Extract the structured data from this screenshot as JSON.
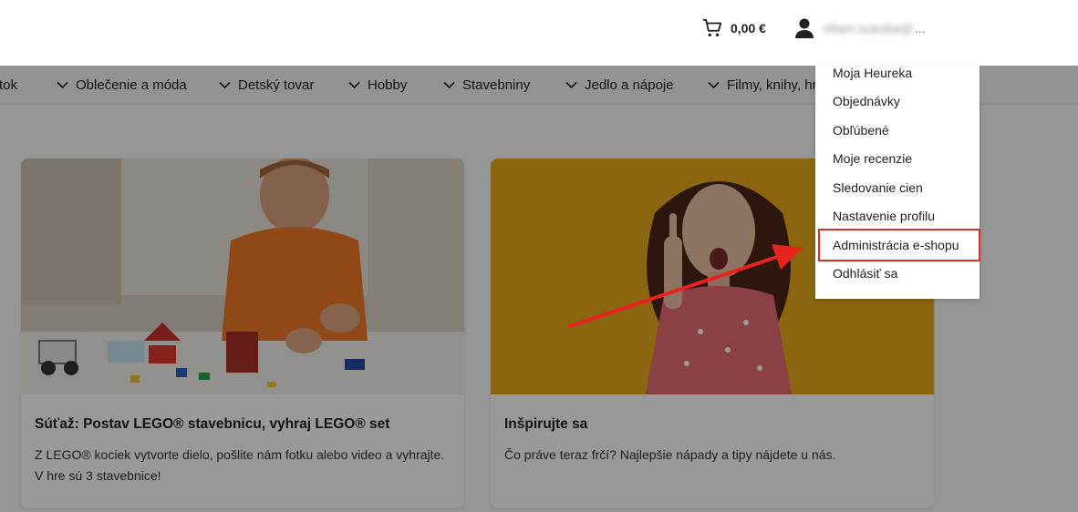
{
  "header": {
    "cart_amount": "0,00 €",
    "user_email": "viliam.sukuba@",
    "user_ellipsis": "..."
  },
  "nav": {
    "items": [
      {
        "label": "tok"
      },
      {
        "label": "Oblečenie a móda"
      },
      {
        "label": "Detský tovar"
      },
      {
        "label": "Hobby"
      },
      {
        "label": "Stavebniny"
      },
      {
        "label": "Jedlo a nápoje"
      },
      {
        "label": "Filmy, knihy, hr"
      }
    ]
  },
  "cards": [
    {
      "title": "Súťaž: Postav LEGO® stavebnicu, vyhraj LEGO® set",
      "text": "Z LEGO® kociek vytvorte dielo, pošlite nám fotku alebo video a vyhrajte. V hre sú 3 stavebnice!"
    },
    {
      "title": "Inšpirujte sa",
      "text": "Čo práve teraz frčí? Najlepšie nápady a tipy nájdete u nás."
    }
  ],
  "dropdown": {
    "items": [
      {
        "label": "Moja Heureka"
      },
      {
        "label": "Objednávky"
      },
      {
        "label": "Obľúbené"
      },
      {
        "label": "Moje recenzie"
      },
      {
        "label": "Sledovanie cien"
      },
      {
        "label": "Nastavenie profilu"
      },
      {
        "label": "Administrácia e-shopu"
      },
      {
        "label": "Odhlásiť sa"
      }
    ]
  },
  "colors": {
    "highlight": "#d9302a",
    "arrow": "#e8231e",
    "card2_background": "#e8a81c"
  }
}
